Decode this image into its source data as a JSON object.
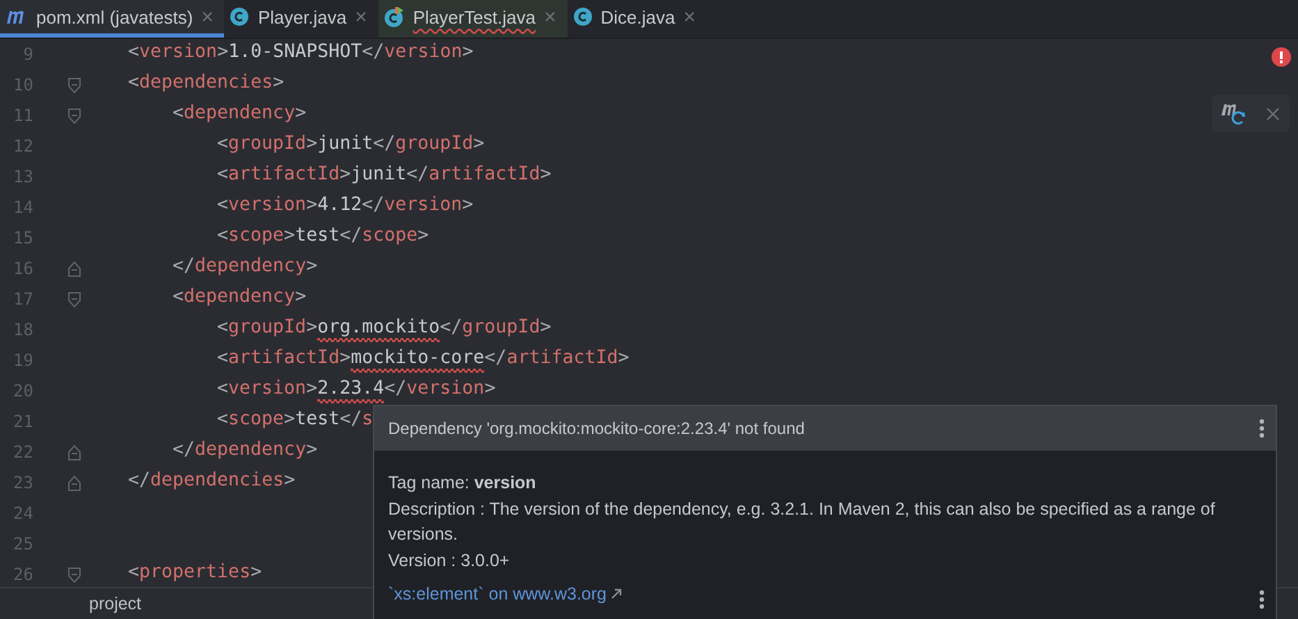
{
  "tabs": [
    {
      "label": "pom.xml (javatests)",
      "kind": "maven",
      "selected": true,
      "error": false
    },
    {
      "label": "Player.java",
      "kind": "class",
      "selected": false,
      "error": false
    },
    {
      "label": "PlayerTest.java",
      "kind": "test",
      "selected": false,
      "error": true
    },
    {
      "label": "Dice.java",
      "kind": "class",
      "selected": false,
      "error": false
    }
  ],
  "tab_close": "×",
  "lines": [
    {
      "number": "9",
      "parts": [
        {
          "kind": "punct",
          "text": "<"
        },
        {
          "kind": "name",
          "text": "version"
        },
        {
          "kind": "punct",
          "text": ">"
        },
        {
          "kind": "text",
          "text": "1.0-SNAPSHOT"
        },
        {
          "kind": "punct",
          "text": "</"
        },
        {
          "kind": "name",
          "text": "version"
        },
        {
          "kind": "punct",
          "text": ">"
        }
      ]
    },
    {
      "number": "10",
      "kind": "fold-start",
      "parts": [
        {
          "kind": "punct",
          "text": "<"
        },
        {
          "kind": "name",
          "text": "dependencies"
        },
        {
          "kind": "punct",
          "text": ">"
        }
      ],
      "children": [
        {
          "number": "11",
          "kind": "fold-start",
          "parts": [
            {
              "kind": "punct",
              "text": "<"
            },
            {
              "kind": "name",
              "text": "dependency"
            },
            {
              "kind": "punct",
              "text": ">"
            }
          ],
          "children": [
            {
              "number": "12",
              "parts": [
                {
                  "kind": "punct",
                  "text": "<"
                },
                {
                  "kind": "name",
                  "text": "groupId"
                },
                {
                  "kind": "punct",
                  "text": ">"
                },
                {
                  "kind": "text",
                  "text": "junit"
                },
                {
                  "kind": "punct",
                  "text": "</"
                },
                {
                  "kind": "name",
                  "text": "groupId"
                },
                {
                  "kind": "punct",
                  "text": ">"
                }
              ]
            },
            {
              "number": "13",
              "parts": [
                {
                  "kind": "punct",
                  "text": "<"
                },
                {
                  "kind": "name",
                  "text": "artifactId"
                },
                {
                  "kind": "punct",
                  "text": ">"
                },
                {
                  "kind": "text",
                  "text": "junit"
                },
                {
                  "kind": "punct",
                  "text": "</"
                },
                {
                  "kind": "name",
                  "text": "artifactId"
                },
                {
                  "kind": "punct",
                  "text": ">"
                }
              ]
            },
            {
              "number": "14",
              "parts": [
                {
                  "kind": "punct",
                  "text": "<"
                },
                {
                  "kind": "name",
                  "text": "version"
                },
                {
                  "kind": "punct",
                  "text": ">"
                },
                {
                  "kind": "text",
                  "text": "4.12"
                },
                {
                  "kind": "punct",
                  "text": "</"
                },
                {
                  "kind": "name",
                  "text": "version"
                },
                {
                  "kind": "punct",
                  "text": ">"
                }
              ]
            },
            {
              "number": "15",
              "parts": [
                {
                  "kind": "punct",
                  "text": "<"
                },
                {
                  "kind": "name",
                  "text": "scope"
                },
                {
                  "kind": "punct",
                  "text": ">"
                },
                {
                  "kind": "text",
                  "text": "test"
                },
                {
                  "kind": "punct",
                  "text": "</"
                },
                {
                  "kind": "name",
                  "text": "scope"
                },
                {
                  "kind": "punct",
                  "text": ">"
                }
              ]
            }
          ]
        },
        {
          "number": "16",
          "kind": "fold-end",
          "parts": [
            {
              "kind": "punct",
              "text": "</"
            },
            {
              "kind": "name",
              "text": "dependency"
            },
            {
              "kind": "punct",
              "text": ">"
            }
          ]
        },
        {
          "number": "17",
          "kind": "fold-start",
          "parts": [
            {
              "kind": "punct",
              "text": "<"
            },
            {
              "kind": "name",
              "text": "dependency"
            },
            {
              "kind": "punct",
              "text": ">"
            }
          ],
          "children": [
            {
              "number": "18",
              "parts": [
                {
                  "kind": "punct",
                  "text": "<"
                },
                {
                  "kind": "name",
                  "text": "groupId"
                },
                {
                  "kind": "punct",
                  "text": ">"
                },
                {
                  "kind": "text",
                  "text": "org.mockito",
                  "error": true
                },
                {
                  "kind": "punct",
                  "text": "</"
                },
                {
                  "kind": "name",
                  "text": "groupId"
                },
                {
                  "kind": "punct",
                  "text": ">"
                }
              ]
            },
            {
              "number": "19",
              "parts": [
                {
                  "kind": "punct",
                  "text": "<"
                },
                {
                  "kind": "name",
                  "text": "artifactId"
                },
                {
                  "kind": "punct",
                  "text": ">"
                },
                {
                  "kind": "text",
                  "text": "mockito-core",
                  "error": true
                },
                {
                  "kind": "punct",
                  "text": "</"
                },
                {
                  "kind": "name",
                  "text": "artifactId"
                },
                {
                  "kind": "punct",
                  "text": ">"
                }
              ]
            },
            {
              "number": "20",
              "parts": [
                {
                  "kind": "punct",
                  "text": "<"
                },
                {
                  "kind": "name",
                  "text": "version"
                },
                {
                  "kind": "punct",
                  "text": ">"
                },
                {
                  "kind": "text",
                  "text": "2.23.4",
                  "error": true
                },
                {
                  "kind": "punct",
                  "text": "</"
                },
                {
                  "kind": "name",
                  "text": "version"
                },
                {
                  "kind": "punct",
                  "text": ">"
                }
              ]
            },
            {
              "number": "21",
              "parts": [
                {
                  "kind": "punct",
                  "text": "<"
                },
                {
                  "kind": "name",
                  "text": "scope"
                },
                {
                  "kind": "punct",
                  "text": ">"
                },
                {
                  "kind": "text",
                  "text": "test"
                },
                {
                  "kind": "punct",
                  "text": "</"
                },
                {
                  "kind": "name",
                  "text": "s"
                }
              ]
            }
          ]
        },
        {
          "number": "22",
          "kind": "fold-end",
          "parts": [
            {
              "kind": "punct",
              "text": "</"
            },
            {
              "kind": "name",
              "text": "dependency"
            },
            {
              "kind": "punct",
              "text": ">"
            }
          ]
        }
      ]
    },
    {
      "number": "23",
      "kind": "fold-end",
      "parts": [
        {
          "kind": "punct",
          "text": "</"
        },
        {
          "kind": "name",
          "text": "dependencies"
        },
        {
          "kind": "punct",
          "text": ">"
        }
      ]
    },
    {
      "number": "24"
    },
    {
      "number": "25"
    },
    {
      "number": "26",
      "kind": "fold-start",
      "parts": [
        {
          "kind": "punct",
          "text": "<"
        },
        {
          "kind": "name",
          "text": "properties"
        },
        {
          "kind": "punct",
          "text": ">"
        }
      ]
    }
  ],
  "breadcrumb": "project",
  "popup": {
    "title": "Dependency 'org.mockito:mockito-core:2.23.4' not found",
    "tag_name": "Tag name: **version**",
    "description": "Description : The version of the dependency, e.g. 3.2.1. In Maven 2, this can also be specified as a range of versions.",
    "version": "Version : 3.0.0+",
    "link": "`xs:element` on www.w3.org"
  }
}
